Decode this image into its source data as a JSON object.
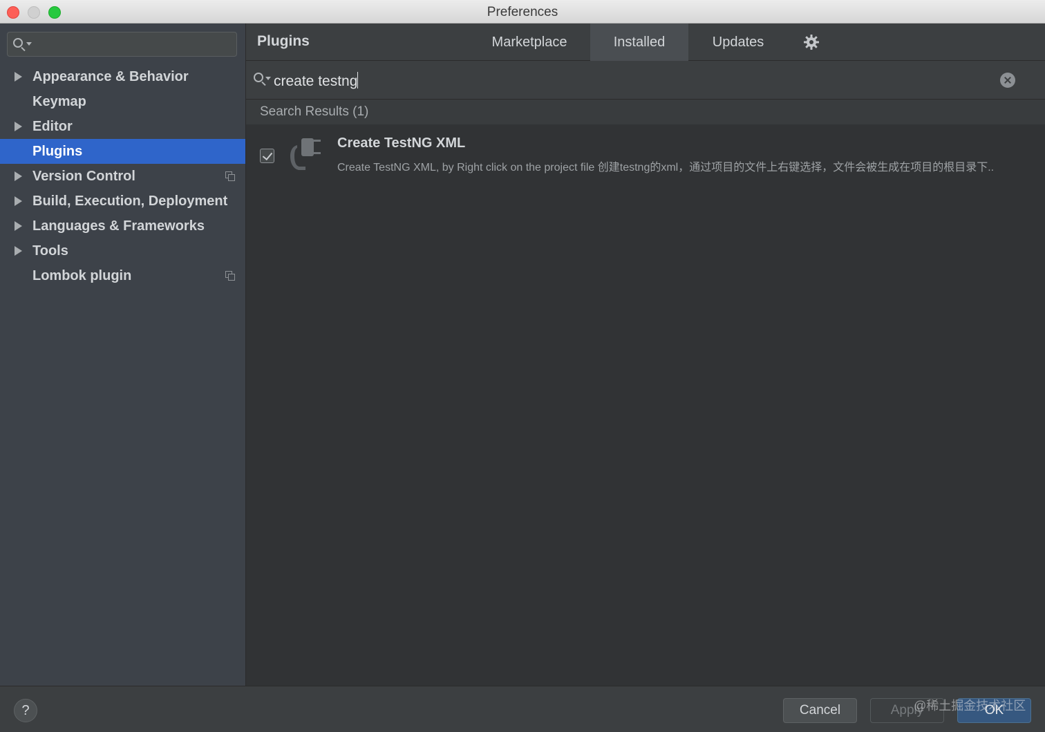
{
  "window": {
    "title": "Preferences"
  },
  "sidebar": {
    "search": {
      "value": ""
    },
    "items": [
      {
        "label": "Appearance & Behavior",
        "expandable": true,
        "project_icon": false,
        "selected": false
      },
      {
        "label": "Keymap",
        "expandable": false,
        "project_icon": false,
        "selected": false
      },
      {
        "label": "Editor",
        "expandable": true,
        "project_icon": false,
        "selected": false
      },
      {
        "label": "Plugins",
        "expandable": false,
        "project_icon": false,
        "selected": true
      },
      {
        "label": "Version Control",
        "expandable": true,
        "project_icon": true,
        "selected": false
      },
      {
        "label": "Build, Execution, Deployment",
        "expandable": true,
        "project_icon": false,
        "selected": false
      },
      {
        "label": "Languages & Frameworks",
        "expandable": true,
        "project_icon": false,
        "selected": false
      },
      {
        "label": "Tools",
        "expandable": true,
        "project_icon": false,
        "selected": false
      },
      {
        "label": "Lombok plugin",
        "expandable": false,
        "project_icon": true,
        "selected": false
      }
    ]
  },
  "plugins": {
    "title": "Plugins",
    "tabs": [
      {
        "label": "Marketplace",
        "active": false
      },
      {
        "label": "Installed",
        "active": true
      },
      {
        "label": "Updates",
        "active": false
      }
    ],
    "settings_icon": "gear-icon",
    "search": {
      "value": "create testng"
    },
    "results_header": "Search Results (1)",
    "results": [
      {
        "name": "Create TestNG XML",
        "description": "Create TestNG XML, by Right click on the project file 创建testng的xml，通过项目的文件上右键选择，文件会被生成在项目的根目录下..",
        "enabled": true,
        "icon": "plugin-icon"
      }
    ]
  },
  "footer": {
    "help_label": "?",
    "cancel_label": "Cancel",
    "apply_label": "Apply",
    "ok_label": "OK",
    "watermark": "@稀土掘金技术社区"
  },
  "colors": {
    "selection": "#2f65ca",
    "ok_button": "#365880",
    "sidebar_bg": "#3d4249",
    "content_bg": "#313335"
  }
}
